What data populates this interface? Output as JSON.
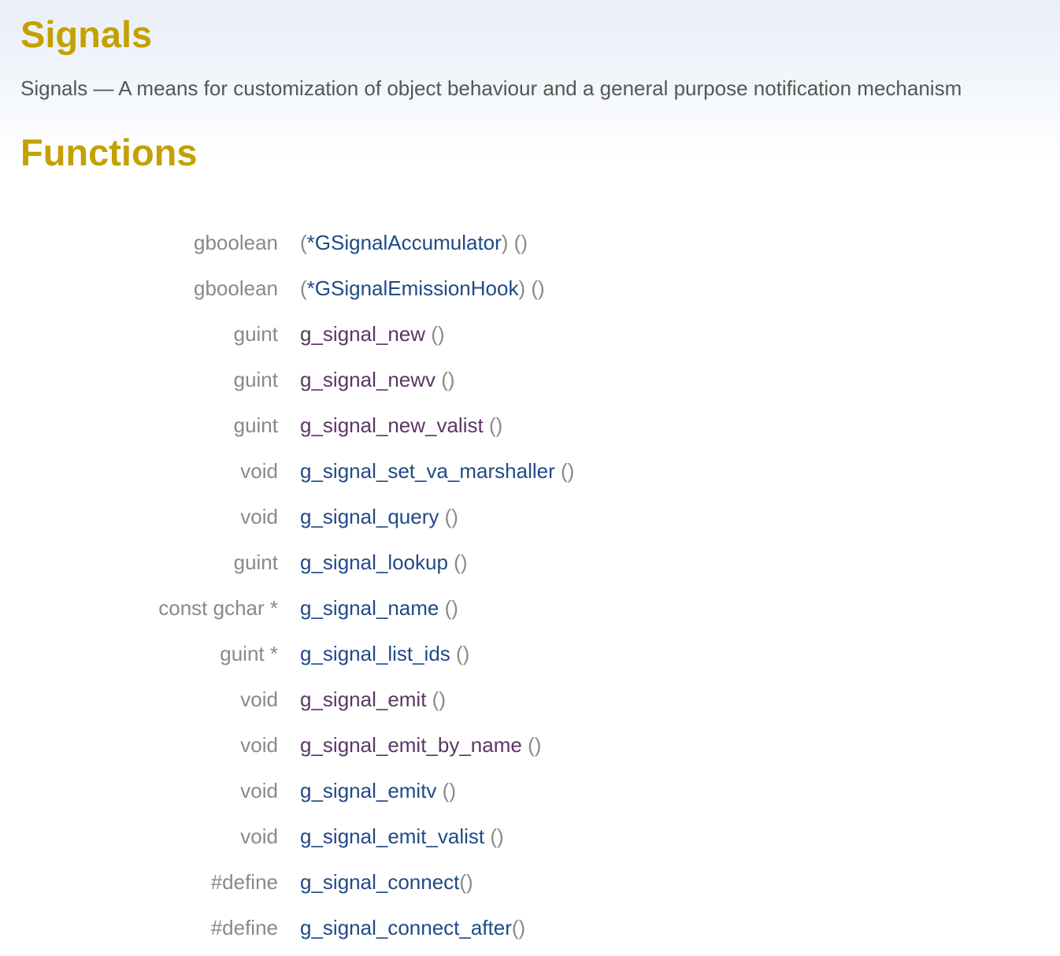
{
  "header": {
    "title": "Signals",
    "purpose": "Signals — A means for customization of object behaviour and a general purpose notification mechanism"
  },
  "functions": {
    "heading": "Functions",
    "colors": {
      "link": "#204a87",
      "visited": "#5c3566",
      "type": "#888a85",
      "heading": "#c4a000"
    },
    "rows": [
      {
        "ret": "gboolean",
        "prefix": "(",
        "name": "*GSignalAccumulator",
        "suffix": ") ()",
        "visited": false
      },
      {
        "ret": "gboolean",
        "prefix": "(",
        "name": "*GSignalEmissionHook",
        "suffix": ") ()",
        "visited": false
      },
      {
        "ret": "guint",
        "prefix": "",
        "name": "g_signal_new",
        "suffix": " ()",
        "visited": true
      },
      {
        "ret": "guint",
        "prefix": "",
        "name": "g_signal_newv",
        "suffix": " ()",
        "visited": true
      },
      {
        "ret": "guint",
        "prefix": "",
        "name": "g_signal_new_valist",
        "suffix": " ()",
        "visited": true
      },
      {
        "ret": "void",
        "prefix": "",
        "name": "g_signal_set_va_marshaller",
        "suffix": " ()",
        "visited": false
      },
      {
        "ret": "void",
        "prefix": "",
        "name": "g_signal_query",
        "suffix": " ()",
        "visited": false
      },
      {
        "ret": "guint",
        "prefix": "",
        "name": "g_signal_lookup",
        "suffix": " ()",
        "visited": false
      },
      {
        "ret": "const gchar *",
        "prefix": "",
        "name": "g_signal_name",
        "suffix": " ()",
        "visited": false
      },
      {
        "ret": "guint *",
        "prefix": "",
        "name": "g_signal_list_ids",
        "suffix": " ()",
        "visited": false
      },
      {
        "ret": "void",
        "prefix": "",
        "name": "g_signal_emit",
        "suffix": " ()",
        "visited": true
      },
      {
        "ret": "void",
        "prefix": "",
        "name": "g_signal_emit_by_name",
        "suffix": " ()",
        "visited": true
      },
      {
        "ret": "void",
        "prefix": "",
        "name": "g_signal_emitv",
        "suffix": " ()",
        "visited": false
      },
      {
        "ret": "void",
        "prefix": "",
        "name": "g_signal_emit_valist",
        "suffix": " ()",
        "visited": false
      },
      {
        "ret": "#define",
        "prefix": "",
        "name": "g_signal_connect",
        "suffix": "()",
        "visited": false
      },
      {
        "ret": "#define",
        "prefix": "",
        "name": "g_signal_connect_after",
        "suffix": "()",
        "visited": false
      }
    ]
  }
}
